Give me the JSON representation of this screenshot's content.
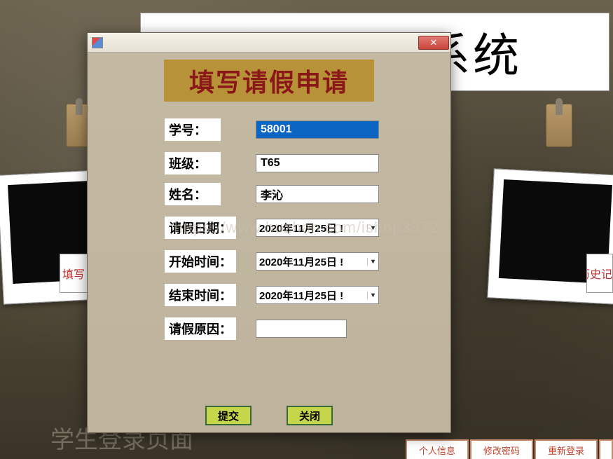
{
  "background": {
    "banner_title": "学生请假系统",
    "left_button": "填写",
    "right_button": "历史记录",
    "footer_text": "学生登录页面",
    "footer_buttons": [
      "个人信息",
      "修改密码",
      "重新登录"
    ]
  },
  "dialog": {
    "title": "填写请假申请",
    "fields": {
      "student_id": {
        "label": "学号：",
        "value": "58001"
      },
      "class": {
        "label": "班级：",
        "value": "T65"
      },
      "name": {
        "label": "姓名：",
        "value": "李沁"
      },
      "leave_date": {
        "label": "请假日期：",
        "value": "2020年11月25日 !"
      },
      "start_time": {
        "label": "开始时间：",
        "value": "2020年11月25日 !"
      },
      "end_time": {
        "label": "结束时间：",
        "value": "2020年11月25日 !"
      },
      "reason": {
        "label": "请假原因：",
        "value": ""
      }
    },
    "buttons": {
      "submit": "提交",
      "close": "关闭"
    }
  },
  "watermark": "https://www.huzhan.com/ishop3572"
}
